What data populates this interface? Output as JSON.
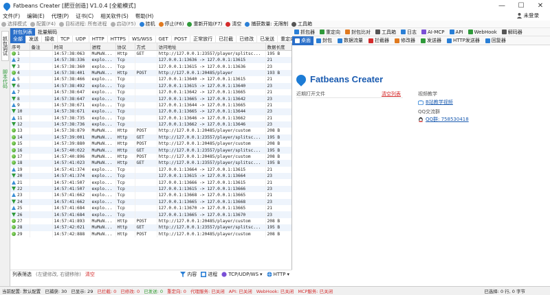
{
  "window": {
    "title": "Fatbeans Creater [肥豆创造] V1.0.4 [全能模式]",
    "controls": [
      "—",
      "☐",
      "✕"
    ]
  },
  "menu": {
    "items": [
      "文件(F)",
      "编辑(E)",
      "代理(P)",
      "证书(C)",
      "相关软件(S)",
      "帮助(H)"
    ],
    "login": "未登录"
  },
  "toolbar1": [
    {
      "label": "选择模式",
      "color": "#b0b0b0",
      "active": false
    },
    {
      "label": "配置(F4)",
      "color": "#b0b0b0",
      "active": false
    },
    {
      "label": "目标进程: 所有进程",
      "color": "#b0b0b0",
      "active": false
    },
    {
      "label": "启动(F5)",
      "color": "#b0b0b0",
      "active": false
    },
    {
      "label": "挂机",
      "color": "#2a7fd6",
      "active": true
    },
    {
      "label": "停止(F6)",
      "color": "#e07a20",
      "active": true
    },
    {
      "label": "重新开始(F7)",
      "color": "#2f9a3a",
      "active": true
    },
    {
      "label": "清空",
      "color": "#d42b2b",
      "active": true
    },
    {
      "label": "捕获数量: 无限制",
      "color": "#2a7fd6",
      "active": true
    },
    {
      "label": "工具箱",
      "color": "#555555",
      "active": true
    }
  ],
  "left_strip": {
    "tab1": "抓包调试",
    "tab2": "脚本代码"
  },
  "left_tabs": [
    "封包列表",
    "批量解码"
  ],
  "filters": [
    "全部",
    "发送",
    "接收",
    "TCP",
    "UDP",
    "HTTP",
    "HTTPS",
    "WS/WSS",
    "GET",
    "POST",
    "正常放行",
    "已拦截",
    "已修改",
    "已发送",
    "重定向"
  ],
  "table": {
    "columns": [
      "序号",
      "备注",
      "时间",
      "进程",
      "协议",
      "方式",
      "访问地址",
      "数据长度"
    ],
    "rows": [
      {
        "icon": "circle",
        "no": "1",
        "note": "",
        "time": "14:57:38:063",
        "proc": "MuMuN...",
        "proto": "Http",
        "method": "GET",
        "url": "http://127.0.0.1:23557/player/splitsc...",
        "len": "195 B"
      },
      {
        "icon": "up",
        "no": "2",
        "note": "",
        "time": "14:57:38:336",
        "proc": "explo...",
        "proto": "Tcp",
        "method": "",
        "url": "127.0.0.1:13636 -> 127.0.0.1:13615",
        "len": "21"
      },
      {
        "icon": "down",
        "no": "3",
        "note": "",
        "time": "14:57:38:360",
        "proc": "explo...",
        "proto": "Tcp",
        "method": "",
        "url": "127.0.0.1:13615 -> 127.0.0.1:13636",
        "len": "23"
      },
      {
        "icon": "circle",
        "no": "4",
        "note": "",
        "time": "14:57:38:401",
        "proc": "MuMuN...",
        "proto": "Http",
        "method": "POST",
        "url": "http://127.0.0.1:20485/player",
        "len": "193 B"
      },
      {
        "icon": "up",
        "no": "5",
        "note": "",
        "time": "14:57:38:466",
        "proc": "explo...",
        "proto": "Tcp",
        "method": "",
        "url": "127.0.0.1:13640 -> 127.0.0.1:13615",
        "len": "21"
      },
      {
        "icon": "down",
        "no": "6",
        "note": "",
        "time": "14:57:38:492",
        "proc": "explo...",
        "proto": "Tcp",
        "method": "",
        "url": "127.0.0.1:13615 -> 127.0.0.1:13640",
        "len": "23"
      },
      {
        "icon": "up",
        "no": "7",
        "note": "",
        "time": "14:57:38:647",
        "proc": "explo...",
        "proto": "Tcp",
        "method": "",
        "url": "127.0.0.1:13642 -> 127.0.0.1:13665",
        "len": "21"
      },
      {
        "icon": "down",
        "no": "8",
        "note": "",
        "time": "14:57:38:647",
        "proc": "explo...",
        "proto": "Tcp",
        "method": "",
        "url": "127.0.0.1:13665 -> 127.0.0.1:13642",
        "len": "23"
      },
      {
        "icon": "up",
        "no": "9",
        "note": "",
        "time": "14:57:38:671",
        "proc": "explo...",
        "proto": "Tcp",
        "method": "",
        "url": "127.0.0.1:13644 -> 127.0.0.1:13665",
        "len": "21"
      },
      {
        "icon": "down",
        "no": "10",
        "note": "",
        "time": "14:57:38:671",
        "proc": "explo...",
        "proto": "Tcp",
        "method": "",
        "url": "127.0.0.1:13665 -> 127.0.0.1:13644",
        "len": "23"
      },
      {
        "icon": "up",
        "no": "11",
        "note": "",
        "time": "14:57:38:735",
        "proc": "explo...",
        "proto": "Tcp",
        "method": "",
        "url": "127.0.0.1:13646 -> 127.0.0.1:13662",
        "len": "21"
      },
      {
        "icon": "down",
        "no": "12",
        "note": "",
        "time": "14:57:38:736",
        "proc": "explo...",
        "proto": "Tcp",
        "method": "",
        "url": "127.0.0.1:13662 -> 127.0.0.1:13646",
        "len": "23"
      },
      {
        "icon": "circle",
        "no": "13",
        "note": "",
        "time": "14:57:38:879",
        "proc": "MuMuN...",
        "proto": "Http",
        "method": "POST",
        "url": "http://127.0.0.1:20485/player/custom",
        "len": "208 B"
      },
      {
        "icon": "circle",
        "no": "14",
        "note": "",
        "time": "14:57:39:001",
        "proc": "MuMuN...",
        "proto": "Http",
        "method": "GET",
        "url": "http://127.0.0.1:23557/player/splitsc...",
        "len": "195 B"
      },
      {
        "icon": "circle",
        "no": "15",
        "note": "",
        "time": "14:57:39:880",
        "proc": "MuMuN...",
        "proto": "Http",
        "method": "POST",
        "url": "http://127.0.0.1:20485/player/custom",
        "len": "208 B"
      },
      {
        "icon": "circle",
        "no": "16",
        "note": "",
        "time": "14:57:40:022",
        "proc": "MuMuN...",
        "proto": "Http",
        "method": "GET",
        "url": "http://127.0.0.1:23557/player/splitsc...",
        "len": "195 B"
      },
      {
        "icon": "circle",
        "no": "17",
        "note": "",
        "time": "14:57:40:896",
        "proc": "MuMuN...",
        "proto": "Http",
        "method": "POST",
        "url": "http://127.0.0.1:20485/player/custom",
        "len": "208 B"
      },
      {
        "icon": "circle",
        "no": "18",
        "note": "",
        "time": "14:57:41:023",
        "proc": "MuMuN...",
        "proto": "Http",
        "method": "GET",
        "url": "http://127.0.0.1:23557/player/splitsc...",
        "len": "195 B"
      },
      {
        "icon": "up",
        "no": "19",
        "note": "",
        "time": "14:57:41:374",
        "proc": "explo...",
        "proto": "Tcp",
        "method": "",
        "url": "127.0.0.1:13664 -> 127.0.0.1:13615",
        "len": "21"
      },
      {
        "icon": "down",
        "no": "20",
        "note": "",
        "time": "14:57:41:374",
        "proc": "explo...",
        "proto": "Tcp",
        "method": "",
        "url": "127.0.0.1:13615 -> 127.0.0.1:13664",
        "len": "23"
      },
      {
        "icon": "up",
        "no": "21",
        "note": "",
        "time": "14:57:41:507",
        "proc": "explo...",
        "proto": "Tcp",
        "method": "",
        "url": "127.0.0.1:13666 -> 127.0.0.1:13615",
        "len": "21"
      },
      {
        "icon": "down",
        "no": "22",
        "note": "",
        "time": "14:57:41:507",
        "proc": "explo...",
        "proto": "Tcp",
        "method": "",
        "url": "127.0.0.1:13615 -> 127.0.0.1:13666",
        "len": "23"
      },
      {
        "icon": "up",
        "no": "23",
        "note": "",
        "time": "14:57:41:662",
        "proc": "explo...",
        "proto": "Tcp",
        "method": "",
        "url": "127.0.0.1:13668 -> 127.0.0.1:13665",
        "len": "21"
      },
      {
        "icon": "down",
        "no": "24",
        "note": "",
        "time": "14:57:41:662",
        "proc": "explo...",
        "proto": "Tcp",
        "method": "",
        "url": "127.0.0.1:13665 -> 127.0.0.1:13668",
        "len": "23"
      },
      {
        "icon": "up",
        "no": "25",
        "note": "",
        "time": "14:57:41:684",
        "proc": "explo...",
        "proto": "Tcp",
        "method": "",
        "url": "127.0.0.1:13670 -> 127.0.0.1:13665",
        "len": "21"
      },
      {
        "icon": "down",
        "no": "26",
        "note": "",
        "time": "14:57:41:684",
        "proc": "explo...",
        "proto": "Tcp",
        "method": "",
        "url": "127.0.0.1:13665 -> 127.0.0.1:13670",
        "len": "23"
      },
      {
        "icon": "circle",
        "no": "27",
        "note": "",
        "time": "14:57:41:893",
        "proc": "MuMuN...",
        "proto": "Http",
        "method": "POST",
        "url": "http://127.0.0.1:20485/player/custom",
        "len": "208 B"
      },
      {
        "icon": "circle",
        "no": "28",
        "note": "",
        "time": "14:57:42:021",
        "proc": "MuMuN...",
        "proto": "Http",
        "method": "GET",
        "url": "http://127.0.0.1:23557/player/splitsc...",
        "len": "195 B"
      },
      {
        "icon": "circle",
        "no": "29",
        "note": "",
        "time": "14:57:42:888",
        "proc": "MuMuN...",
        "proto": "Http",
        "method": "POST",
        "url": "http://127.0.0.1:20485/player/custom",
        "len": "208 B"
      }
    ]
  },
  "list_filter": {
    "label": "列表筛选",
    "hint": "(左键修改, 右键移除)",
    "clear": "清空",
    "content": "内容",
    "process": "进程",
    "tcp": "TCP/UDP/WS",
    "http": "HTTP"
  },
  "status": {
    "config": "当前配置: 默认配置",
    "captured": "已捕获: 30",
    "shown": "已显示: 29",
    "intercepted": "已拦截: 0",
    "modified": "已修改: 0",
    "sent": "已发送: 0",
    "redirected": "重定向: 0",
    "proxy": "代理服务: 已关闭",
    "api": "API: 已关闭",
    "webhook": "WebHook: 已关闭",
    "mcp": "MCP服务: 已关闭",
    "selected": "已选择: 0 行, 0 字节"
  },
  "toolbar2": [
    {
      "label": "抓包器",
      "color": "#2a7fd6"
    },
    {
      "label": "重定向",
      "color": "#2f9a3a"
    },
    {
      "label": "封包比对",
      "color": "#e07a20"
    },
    {
      "label": "工具箱",
      "color": "#555555"
    },
    {
      "label": "日志",
      "color": "#2a7fd6"
    },
    {
      "label": "AI-MCP",
      "color": "#7a4fd6"
    },
    {
      "label": "API",
      "color": "#2a7fd6"
    },
    {
      "label": "WebHook",
      "color": "#2f9a3a"
    },
    {
      "label": "解码器",
      "color": "#555555"
    }
  ],
  "toolbar3": [
    {
      "label": "桌面",
      "color": "#ffffff",
      "selected": true
    },
    {
      "label": "封包",
      "color": "#2a7fd6",
      "selected": false
    },
    {
      "label": "数据流量",
      "color": "#2a7fd6",
      "selected": false
    },
    {
      "label": "拦截器",
      "color": "#d42b2b",
      "selected": false
    },
    {
      "label": "修改器",
      "color": "#e07a20",
      "selected": false
    },
    {
      "label": "发送器",
      "color": "#2f9a3a",
      "selected": false
    },
    {
      "label": "HTTP发送器",
      "color": "#2a7fd6",
      "selected": false
    },
    {
      "label": "回复器",
      "color": "#2a7fd6",
      "selected": false
    }
  ],
  "welcome": {
    "brand": "Fatbeans Creater",
    "recent_label": "近期打开文件",
    "clear_label": "清空列表",
    "video_label": "视频教学",
    "video_link": "B站教学视频",
    "qq_label": "QQ交流群",
    "qq_link": "QQ群: 758530418"
  }
}
